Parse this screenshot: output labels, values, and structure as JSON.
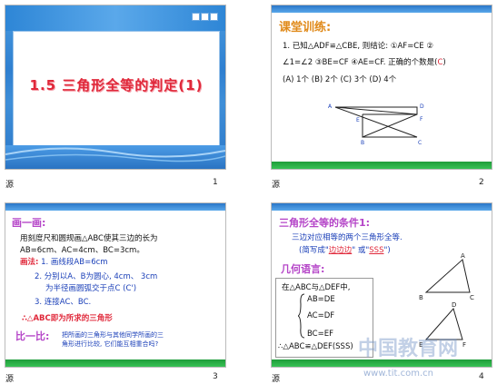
{
  "slides": [
    {
      "number": "1",
      "footer_left": "源",
      "title": "1.5 三角形全等的判定(1)"
    },
    {
      "number": "2",
      "footer_left": "源",
      "heading": "课堂训练:",
      "q_line1": "1.  已知△ADF≌△CBE, 则结论: ①AF=CE ②",
      "q_line2a": "∠1=∠2 ③BE=CF ④AE=CF. 正确的个数是",
      "q_answer": "C",
      "q_line3": "(A) 1个 (B) 2个 (C) 3个 (D) 4个",
      "fig_labels": [
        "A",
        "E",
        "F",
        "D",
        "B",
        "C"
      ]
    },
    {
      "number": "3",
      "footer_left": "源",
      "heading": "画一画:",
      "line1": "用刻度尺和圆规画△ABC使其三边的长为",
      "line2": "AB=6cm、AC=4cm、BC=3cm。",
      "steps_label": "画法:",
      "step1": "1. 画线段AB=6cm",
      "step2a": "2. 分别以A、B为圆心, 4cm、 3cm",
      "step2b": "为半径画圆弧交于点C (C')",
      "step3": "3. 连接AC、BC.",
      "conclusion": "∴△ABC即为所求的三角形",
      "compare_label": "比一比:",
      "compare_text1": "把所画的三角形与其他同学所画的三",
      "compare_text2": "角形进行比较, 它们能互相重合吗?"
    },
    {
      "number": "4",
      "footer_left": "源",
      "heading": "三角形全等的条件1:",
      "line1": "三边对应相等的两个三角形全等.",
      "line2_pre": "(简写成\"",
      "line2_a": "边边边",
      "line2_mid": "\" 或\"",
      "line2_b": "SSS",
      "line2_post": "\")",
      "geo_label": "几何语言:",
      "geo_line1": "在△ABC与△DEF中,",
      "cond1": "AB=DE",
      "cond2": "AC=DF",
      "cond3": "BC=EF",
      "result": "∴△ABC≌△DEF(SSS)",
      "fig_labels": [
        "A",
        "B",
        "C",
        "D",
        "E",
        "F"
      ],
      "watermark": "中国教育网",
      "watermark_url": "www.tit.com.cn"
    }
  ],
  "colors": {
    "accent_red": "#e0283a",
    "purple": "#b545c8",
    "blue": "#2a76c8",
    "green": "#1f9c3a"
  }
}
